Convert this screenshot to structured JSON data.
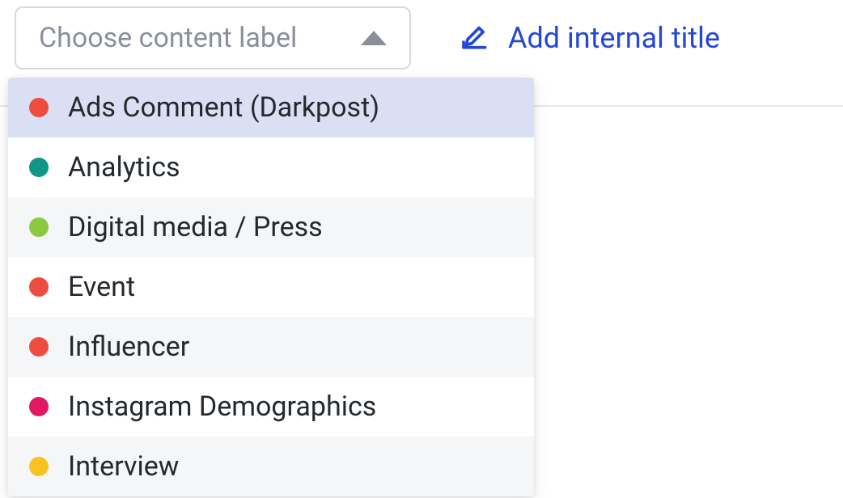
{
  "select": {
    "placeholder": "Choose content label"
  },
  "addTitle": {
    "label": "Add internal title"
  },
  "colors": {
    "red": "#ee4c3e",
    "teal": "#0f9687",
    "green": "#8bc940",
    "magenta": "#e31864",
    "yellow": "#f6c321"
  },
  "options": [
    {
      "label": "Ads Comment (Darkpost)",
      "colorKey": "red",
      "highlighted": true
    },
    {
      "label": "Analytics",
      "colorKey": "teal",
      "highlighted": false
    },
    {
      "label": "Digital media / Press",
      "colorKey": "green",
      "highlighted": false
    },
    {
      "label": "Event",
      "colorKey": "red",
      "highlighted": false
    },
    {
      "label": "Influencer",
      "colorKey": "red",
      "highlighted": false
    },
    {
      "label": "Instagram Demographics",
      "colorKey": "magenta",
      "highlighted": false
    },
    {
      "label": "Interview",
      "colorKey": "yellow",
      "highlighted": false
    }
  ]
}
